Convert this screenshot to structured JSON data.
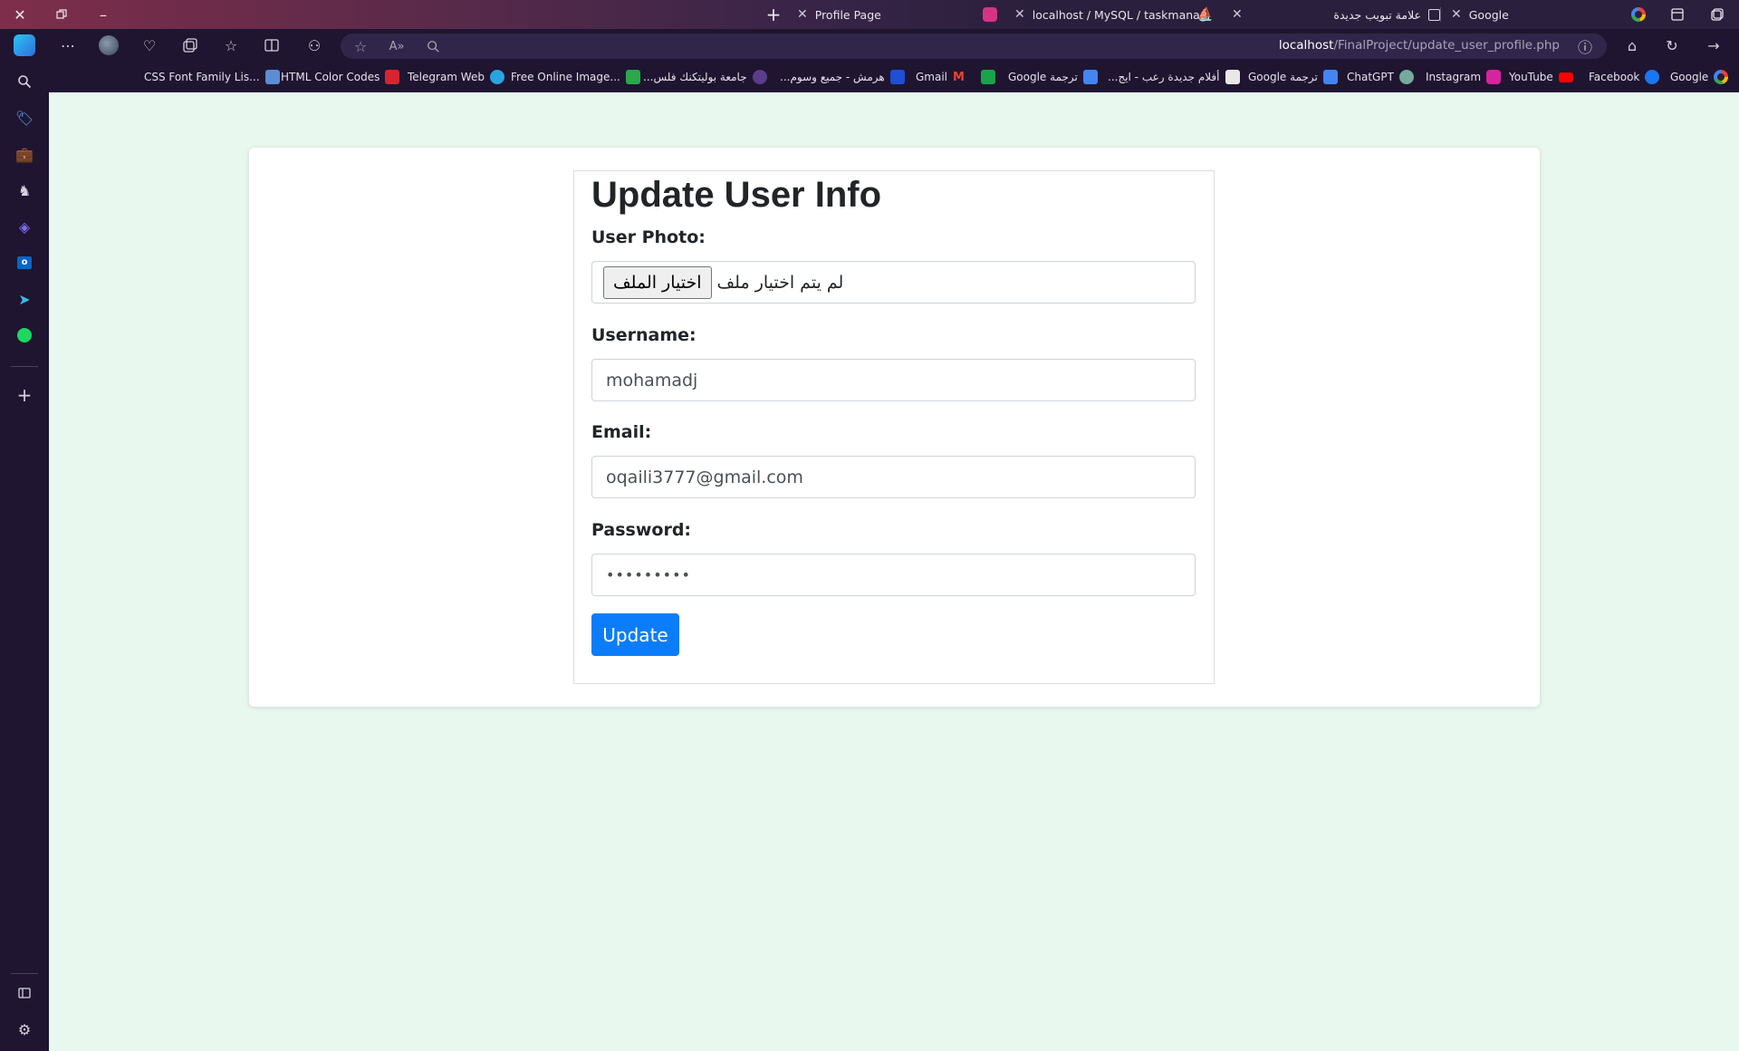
{
  "window": {
    "tabs": [
      {
        "title": "Profile Page",
        "active": true
      },
      {
        "title": "localhost / MySQL / taskmanagm"
      },
      {
        "title": "علامة تبويب جديدة"
      },
      {
        "title": "Google"
      }
    ]
  },
  "toolbar": {
    "url_host": "localhost",
    "url_path": "/FinalProject/update_user_profile.php"
  },
  "bookmarks": [
    {
      "label": "CSS Font Family Lis...",
      "color": "#5b8dd6"
    },
    {
      "label": "HTML Color Codes",
      "color": "#d8242f"
    },
    {
      "label": "Telegram Web",
      "color": "#2aa3e0"
    },
    {
      "label": "Free Online Image...",
      "color": "#2aa84a"
    },
    {
      "label": "جامعة بوليتكنك فلس...",
      "color": "#5a3d8a"
    },
    {
      "label": "هرمش - جميع وسوم...",
      "color": "#1d4fd8"
    },
    {
      "label": "Gmail",
      "color": "#ea4335"
    },
    {
      "label": "Google ترجمة",
      "color": "#4285f4"
    },
    {
      "label": "أفلام جديدة رعب - ايج...",
      "color": "#e8e8e8"
    },
    {
      "label": "Google ترجمة",
      "color": "#4285f4"
    },
    {
      "label": "ChatGPT",
      "color": "#74aa9c"
    },
    {
      "label": "Instagram",
      "color": "#d6249f"
    },
    {
      "label": "YouTube",
      "color": "#ff0000"
    },
    {
      "label": "Facebook",
      "color": "#1877f2"
    },
    {
      "label": "Google",
      "color": "#4285f4"
    }
  ],
  "form": {
    "title": "Update User Info",
    "photo_label": "User Photo:",
    "file_button": "اختيار الملف",
    "file_status": "لم يتم اختيار ملف",
    "username_label": "Username:",
    "username_value": "mohamadj",
    "email_label": "Email:",
    "email_value": "oqaili3777@gmail.com",
    "password_label": "Password:",
    "password_value": "•••••••••",
    "submit_label": "Update"
  },
  "colors": {
    "page_background": "#e8f8ee",
    "primary_button": "#0b7dfb",
    "browser_chrome": "#1f1530"
  }
}
